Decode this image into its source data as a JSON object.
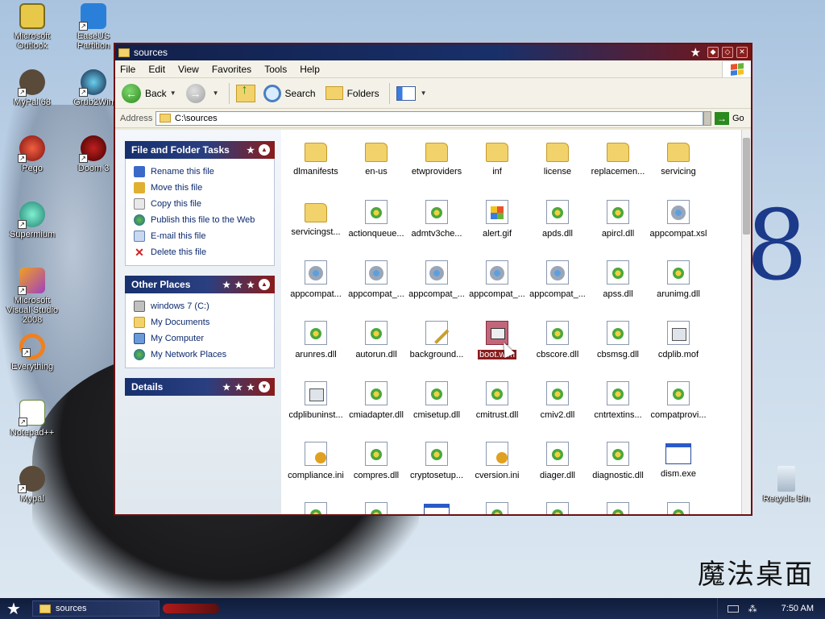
{
  "desktop": {
    "icons": [
      {
        "label": "Microsoft Outlook"
      },
      {
        "label": "EaseUS Partition"
      },
      {
        "label": "MyPal 68"
      },
      {
        "label": "Grub2Win"
      },
      {
        "label": "Pego"
      },
      {
        "label": "Doom 3"
      },
      {
        "label": "Supermium"
      },
      {
        "label": "Microsoft Visual Studio 2008"
      },
      {
        "label": "Everything"
      },
      {
        "label": "Notepad++"
      },
      {
        "label": "Mypal"
      },
      {
        "label": "Recycle Bin"
      }
    ]
  },
  "window": {
    "title": "sources",
    "menu": [
      "File",
      "Edit",
      "View",
      "Favorites",
      "Tools",
      "Help"
    ],
    "toolbar": {
      "back_label": "Back",
      "search_label": "Search",
      "folders_label": "Folders"
    },
    "address": {
      "label": "Address",
      "value": "C:\\sources",
      "go_label": "Go"
    }
  },
  "tasks_panel": {
    "title": "File and Folder Tasks",
    "items": [
      {
        "label": "Rename this file",
        "icon": "rename-icon"
      },
      {
        "label": "Move this file",
        "icon": "move-icon"
      },
      {
        "label": "Copy this file",
        "icon": "copy-icon"
      },
      {
        "label": "Publish this file to the Web",
        "icon": "globe-icon"
      },
      {
        "label": "E-mail this file",
        "icon": "email-icon"
      },
      {
        "label": "Delete this file",
        "icon": "delete-icon"
      }
    ]
  },
  "places_panel": {
    "title": "Other Places",
    "items": [
      {
        "label": "windows 7 (C:)",
        "icon": "drive-icon"
      },
      {
        "label": "My Documents",
        "icon": "documents-icon"
      },
      {
        "label": "My Computer",
        "icon": "computer-icon"
      },
      {
        "label": "My Network Places",
        "icon": "network-icon"
      }
    ]
  },
  "details_panel": {
    "title": "Details"
  },
  "files": [
    {
      "name": "dlmanifests",
      "type": "folder"
    },
    {
      "name": "en-us",
      "type": "folder"
    },
    {
      "name": "etwproviders",
      "type": "folder"
    },
    {
      "name": "inf",
      "type": "folder"
    },
    {
      "name": "license",
      "type": "folder"
    },
    {
      "name": "replacemen...",
      "type": "folder"
    },
    {
      "name": "servicing",
      "type": "folder"
    },
    {
      "name": "servicingst...",
      "type": "folder"
    },
    {
      "name": "actionqueue...",
      "type": "dll"
    },
    {
      "name": "admtv3che...",
      "type": "dll"
    },
    {
      "name": "alert.gif",
      "type": "gif"
    },
    {
      "name": "apds.dll",
      "type": "dll"
    },
    {
      "name": "apircl.dll",
      "type": "dll"
    },
    {
      "name": "appcompat.xsl",
      "type": "xsl"
    },
    {
      "name": "appcompat...",
      "type": "xsl"
    },
    {
      "name": "appcompat_...",
      "type": "xsl"
    },
    {
      "name": "appcompat_...",
      "type": "xsl"
    },
    {
      "name": "appcompat_...",
      "type": "xsl"
    },
    {
      "name": "appcompat_...",
      "type": "xsl"
    },
    {
      "name": "apss.dll",
      "type": "dll"
    },
    {
      "name": "arunimg.dll",
      "type": "dll"
    },
    {
      "name": "arunres.dll",
      "type": "dll"
    },
    {
      "name": "autorun.dll",
      "type": "dll"
    },
    {
      "name": "background...",
      "type": "bg"
    },
    {
      "name": "boot.wim",
      "type": "bcd",
      "selected": true
    },
    {
      "name": "cbscore.dll",
      "type": "dll"
    },
    {
      "name": "cbsmsg.dll",
      "type": "dll"
    },
    {
      "name": "cdplib.mof",
      "type": "doc"
    },
    {
      "name": "cdplibuninst...",
      "type": "doc"
    },
    {
      "name": "cmiadapter.dll",
      "type": "dll"
    },
    {
      "name": "cmisetup.dll",
      "type": "dll"
    },
    {
      "name": "cmitrust.dll",
      "type": "dll"
    },
    {
      "name": "cmiv2.dll",
      "type": "dll"
    },
    {
      "name": "cntrtextins...",
      "type": "dll"
    },
    {
      "name": "compatprovi...",
      "type": "dll"
    },
    {
      "name": "compliance.ini",
      "type": "ini"
    },
    {
      "name": "compres.dll",
      "type": "dll"
    },
    {
      "name": "cryptosetup...",
      "type": "dll"
    },
    {
      "name": "cversion.ini",
      "type": "ini"
    },
    {
      "name": "diager.dll",
      "type": "dll"
    },
    {
      "name": "diagnostic.dll",
      "type": "dll"
    },
    {
      "name": "dism.exe",
      "type": "exe"
    },
    {
      "name": "",
      "type": "dll"
    },
    {
      "name": "",
      "type": "dll"
    },
    {
      "name": "",
      "type": "exe"
    },
    {
      "name": "",
      "type": "dll"
    },
    {
      "name": "",
      "type": "dll"
    },
    {
      "name": "",
      "type": "dll"
    },
    {
      "name": "",
      "type": "dll"
    }
  ],
  "taskbar": {
    "window_button": "sources",
    "clock": "7:50 AM"
  },
  "wallpaper": {
    "logo_text": "魔法桌面",
    "big_digit": "8"
  }
}
